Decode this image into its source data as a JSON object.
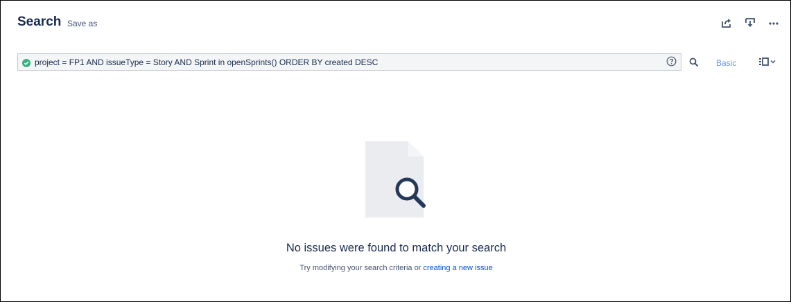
{
  "header": {
    "title": "Search",
    "save_as": "Save as",
    "actions": [
      {
        "icon": "share-icon"
      },
      {
        "icon": "export-icon"
      },
      {
        "icon": "more-icon"
      }
    ]
  },
  "query": {
    "status_icon": "valid-check-icon",
    "status_color": "#36b37e",
    "text": "project = FP1 AND issueType = Story AND Sprint in openSprints() ORDER BY created DESC",
    "help_icon": "help-icon"
  },
  "toolbar": {
    "search_icon": "search-icon",
    "basic_label": "Basic",
    "layout_icon": "layout-switcher-icon"
  },
  "empty_state": {
    "illustration": "document-search-illustration",
    "title": "No issues were found to match your search",
    "subtitle_prefix": "Try modifying your search criteria or ",
    "subtitle_link": "creating a new issue"
  },
  "colors": {
    "link": "#0052cc",
    "basic_link": "#6b9be0",
    "text": "#172b4d"
  }
}
